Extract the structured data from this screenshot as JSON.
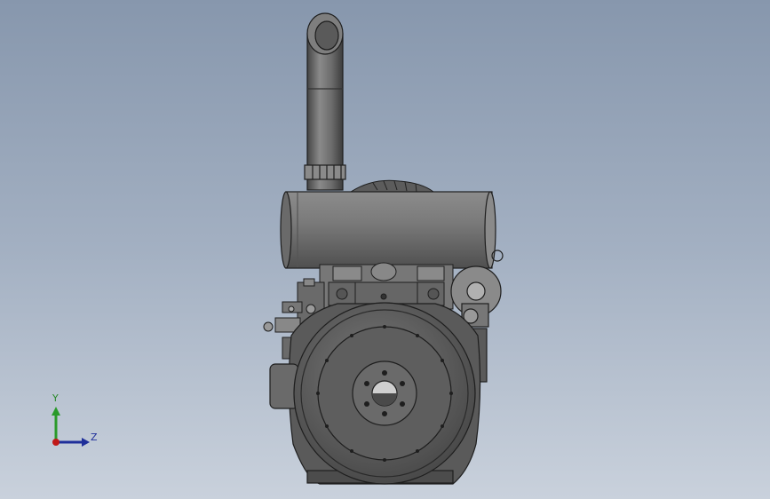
{
  "view": {
    "model_icon": "engine-model-icon",
    "colors": {
      "background_top": "#8797ad",
      "background_bottom": "#c9d1dc",
      "body": "#6f6f6f",
      "body_dark": "#3a3a3a",
      "outline": "#1e1e1e"
    }
  },
  "triad": {
    "y_label": "Y",
    "z_label": "Z",
    "colors": {
      "y": "#2a9a2a",
      "z": "#1f2f9a",
      "origin": "#c01818"
    }
  }
}
